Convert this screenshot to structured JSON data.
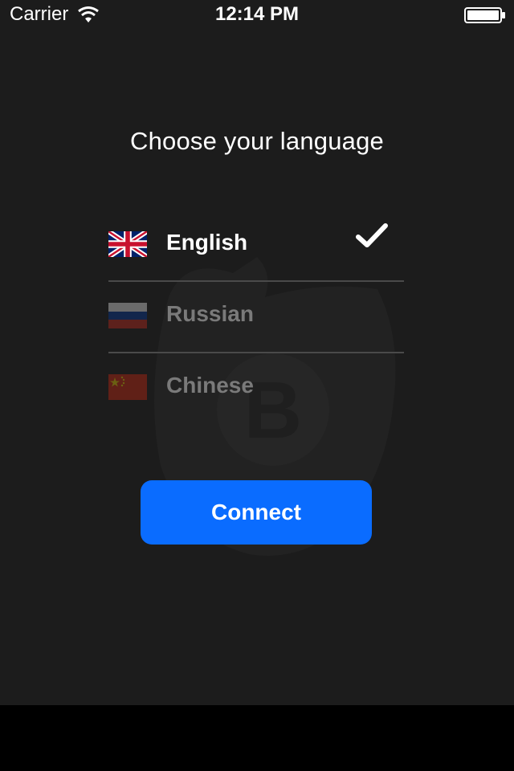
{
  "status_bar": {
    "carrier": "Carrier",
    "time": "12:14 PM",
    "wifi_icon": "wifi-icon",
    "battery_icon": "battery-full-icon"
  },
  "title": "Choose your language",
  "languages": [
    {
      "label": "English",
      "flag_icon": "uk-flag-icon",
      "selected": true
    },
    {
      "label": "Russian",
      "flag_icon": "russia-flag-icon",
      "selected": false
    },
    {
      "label": "Chinese",
      "flag_icon": "china-flag-icon",
      "selected": false
    }
  ],
  "selected_icon": "checkmark-icon",
  "connect_label": "Connect",
  "colors": {
    "background": "#1c1c1c",
    "accent": "#0a6cff",
    "text": "#ffffff",
    "text_dim": "#7a7a7a",
    "divider": "#4a4a4a"
  }
}
